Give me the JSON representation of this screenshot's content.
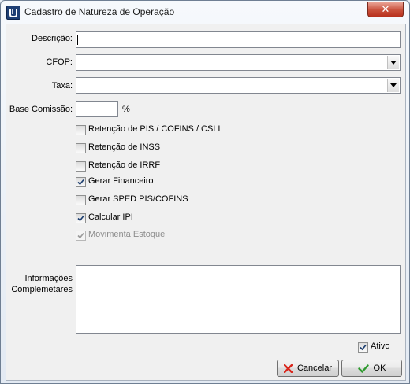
{
  "window": {
    "title": "Cadastro de Natureza de Operação",
    "close_label": "✕"
  },
  "form": {
    "descricao_label": "Descrição:",
    "descricao_value": "",
    "cfop_label": "CFOP:",
    "cfop_value": "",
    "taxa_label": "Taxa:",
    "taxa_value": "",
    "base_comissao_label": "Base Comissão:",
    "base_comissao_value": "",
    "percent_label": "%",
    "checkboxes": [
      {
        "label": "Retenção de PIS / COFINS / CSLL",
        "checked": false,
        "enabled": true
      },
      {
        "label": "Retenção de INSS",
        "checked": false,
        "enabled": true
      },
      {
        "label": "Retenção de IRRF",
        "checked": false,
        "enabled": true
      },
      {
        "label": "Gerar Financeiro",
        "checked": true,
        "enabled": true
      },
      {
        "label": "Gerar SPED PIS/COFINS",
        "checked": false,
        "enabled": true
      },
      {
        "label": "Calcular IPI",
        "checked": true,
        "enabled": true
      },
      {
        "label": "Movimenta Estoque",
        "checked": true,
        "enabled": false
      }
    ],
    "informacoes_label_1": "Informações",
    "informacoes_label_2": "Complemetares",
    "informacoes_value": "",
    "ativo_label": "Ativo",
    "ativo_checked": true
  },
  "buttons": {
    "cancel_label": "Cancelar",
    "ok_label": "OK"
  },
  "colors": {
    "cancel_icon": "#d9261c",
    "ok_icon": "#2e9a2e"
  }
}
